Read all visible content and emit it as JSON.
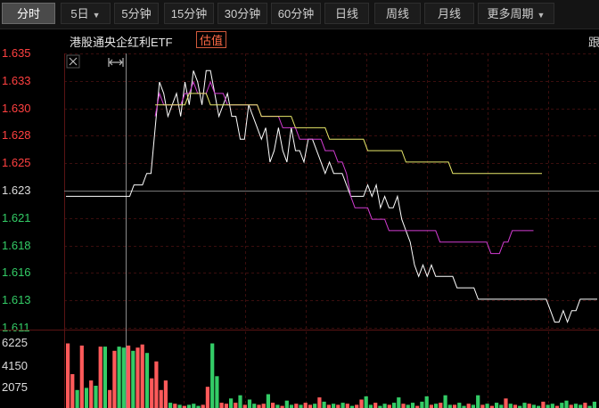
{
  "toolbar": {
    "tabs": [
      {
        "label": "分时",
        "active": true
      },
      {
        "label": "5日",
        "dropdown": true
      },
      {
        "label": "5分钟"
      },
      {
        "label": "15分钟"
      },
      {
        "label": "30分钟"
      },
      {
        "label": "60分钟"
      },
      {
        "label": "日线"
      },
      {
        "label": "周线"
      },
      {
        "label": "月线"
      },
      {
        "label": "更多周期",
        "dropdown": true
      }
    ]
  },
  "header": {
    "title": "港股通央企红利ETF",
    "badge": "估值",
    "cut_text": "跟"
  },
  "chart_data": {
    "type": "line",
    "price_axis": {
      "ticks": [
        "1.635",
        "1.633",
        "1.630",
        "1.628",
        "1.625",
        "1.623",
        "1.621",
        "1.618",
        "1.616",
        "1.613",
        "1.611"
      ],
      "ylim": [
        1.611,
        1.635
      ],
      "reference": 1.623
    },
    "volume_axis": {
      "ticks": [
        "6225",
        "4150",
        "2075"
      ]
    },
    "series": [
      {
        "color": "#ffffff",
        "values": [
          1.6225,
          1.6225,
          1.6225,
          1.6225,
          1.6225,
          1.6225,
          1.6225,
          1.6225,
          1.6225,
          1.6225,
          1.6225,
          1.6225,
          1.6225,
          1.6225,
          1.6225,
          1.6225,
          1.6235,
          1.6235,
          1.6235,
          1.6245,
          1.6245,
          1.6285,
          1.6325,
          1.6315,
          1.6295,
          1.6305,
          1.6315,
          1.6295,
          1.6325,
          1.6305,
          1.6335,
          1.6325,
          1.6305,
          1.6335,
          1.6335,
          1.6315,
          1.6295,
          1.6305,
          1.6315,
          1.6295,
          1.6295,
          1.6275,
          1.6275,
          1.6305,
          1.6295,
          1.6285,
          1.6275,
          1.6285,
          1.6255,
          1.6265,
          1.6285,
          1.6265,
          1.6255,
          1.6285,
          1.6265,
          1.6265,
          1.6255,
          1.6275,
          1.6275,
          1.6265,
          1.6255,
          1.6245,
          1.6255,
          1.6245,
          1.6245,
          1.6245,
          1.6235,
          1.6225,
          1.6225,
          1.6225,
          1.6225,
          1.6235,
          1.6225,
          1.6235,
          1.6215,
          1.6225,
          1.6215,
          1.6215,
          1.6225,
          1.6205,
          1.6195,
          1.6185,
          1.6165,
          1.6155,
          1.6165,
          1.6155,
          1.6165,
          1.6155,
          1.6155,
          1.6155,
          1.6155,
          1.6155,
          1.6145,
          1.6145,
          1.6145,
          1.6145,
          1.6145,
          1.6135,
          1.6135,
          1.6135,
          1.6135,
          1.6135,
          1.6135,
          1.6135,
          1.6135,
          1.6135,
          1.6135,
          1.6135,
          1.6135,
          1.6135,
          1.6135,
          1.6135,
          1.6135,
          1.6135,
          1.6125,
          1.6115,
          1.6115,
          1.6125,
          1.6115,
          1.6125,
          1.6125,
          1.6135,
          1.6135,
          1.6135,
          1.6135,
          1.6135
        ]
      },
      {
        "color": "#d23cd2",
        "values": [
          null,
          null,
          null,
          null,
          null,
          null,
          null,
          null,
          null,
          null,
          null,
          null,
          null,
          null,
          null,
          null,
          null,
          null,
          null,
          null,
          null,
          1.6295,
          1.6315,
          1.6305,
          1.6305,
          1.6305,
          1.6305,
          1.6305,
          1.6315,
          1.6315,
          1.6325,
          1.6315,
          1.6315,
          1.6315,
          1.6325,
          1.6315,
          1.6315,
          1.6315,
          1.6305,
          1.6305,
          1.6305,
          1.6305,
          1.6305,
          1.6305,
          1.6305,
          1.6305,
          1.6295,
          1.6295,
          1.6295,
          1.6295,
          1.6295,
          1.6285,
          1.6285,
          1.6285,
          1.6285,
          1.6275,
          1.6275,
          1.6275,
          1.6275,
          1.6275,
          1.6275,
          1.6265,
          1.6265,
          1.6265,
          1.6255,
          1.6255,
          1.6245,
          1.6225,
          1.6215,
          1.6215,
          1.6215,
          1.6215,
          1.6205,
          1.6205,
          1.6205,
          1.6205,
          1.6195,
          1.6195,
          1.6195,
          1.6195,
          1.6195,
          1.6195,
          1.6195,
          1.6195,
          1.6195,
          1.6195,
          1.6195,
          1.6195,
          1.6185,
          1.6185,
          1.6185,
          1.6185,
          1.6185,
          1.6185,
          1.6185,
          1.6185,
          1.6185,
          1.6185,
          1.6185,
          1.6185,
          1.6175,
          1.6175,
          1.6175,
          1.6185,
          1.6185,
          1.6195,
          1.6195,
          1.6195,
          1.6195,
          1.6195,
          1.6195
        ]
      },
      {
        "color": "#e8e86a",
        "values": [
          null,
          null,
          null,
          null,
          null,
          null,
          null,
          null,
          null,
          null,
          null,
          null,
          null,
          null,
          null,
          null,
          null,
          null,
          null,
          null,
          null,
          1.6305,
          1.6305,
          1.6305,
          1.6305,
          1.6305,
          1.6305,
          1.6305,
          1.6305,
          1.6315,
          1.6315,
          1.6315,
          1.6315,
          1.6315,
          1.6305,
          1.6305,
          1.6305,
          1.6305,
          1.6305,
          1.6305,
          1.6305,
          1.6305,
          1.6305,
          1.6305,
          1.6305,
          1.6305,
          1.6295,
          1.6295,
          1.6295,
          1.6295,
          1.6295,
          1.6295,
          1.6295,
          1.6295,
          1.6285,
          1.6285,
          1.6285,
          1.6285,
          1.6285,
          1.6285,
          1.6285,
          1.6285,
          1.6275,
          1.6275,
          1.6275,
          1.6275,
          1.6275,
          1.6275,
          1.6275,
          1.6275,
          1.6275,
          1.6265,
          1.6265,
          1.6265,
          1.6265,
          1.6265,
          1.6265,
          1.6265,
          1.6265,
          1.6265,
          1.6255,
          1.6255,
          1.6255,
          1.6255,
          1.6255,
          1.6255,
          1.6255,
          1.6255,
          1.6255,
          1.6255,
          1.6255,
          1.6245,
          1.6245,
          1.6245,
          1.6245,
          1.6245,
          1.6245,
          1.6245,
          1.6245,
          1.6245,
          1.6245,
          1.6245,
          1.6245,
          1.6245,
          1.6245,
          1.6245,
          1.6245,
          1.6245,
          1.6245,
          1.6245,
          1.6245,
          1.6245,
          1.6245
        ]
      }
    ],
    "volume_bars": [
      {
        "v": 6100,
        "c": "r"
      },
      {
        "v": 3200,
        "c": "r"
      },
      {
        "v": 1700,
        "c": "g"
      },
      {
        "v": 5900,
        "c": "r"
      },
      {
        "v": 1900,
        "c": "g"
      },
      {
        "v": 2600,
        "c": "r"
      },
      {
        "v": 2100,
        "c": "g"
      },
      {
        "v": 5800,
        "c": "r"
      },
      {
        "v": 5800,
        "c": "g"
      },
      {
        "v": 1700,
        "c": "r"
      },
      {
        "v": 5400,
        "c": "r"
      },
      {
        "v": 5800,
        "c": "g"
      },
      {
        "v": 5700,
        "c": "g"
      },
      {
        "v": 5900,
        "c": "r"
      },
      {
        "v": 5400,
        "c": "g"
      },
      {
        "v": 5700,
        "c": "r"
      },
      {
        "v": 6000,
        "c": "r"
      },
      {
        "v": 5200,
        "c": "g"
      },
      {
        "v": 2800,
        "c": "r"
      },
      {
        "v": 4400,
        "c": "r"
      },
      {
        "v": 1700,
        "c": "r"
      },
      {
        "v": 2600,
        "c": "r"
      },
      {
        "v": 500,
        "c": "g"
      },
      {
        "v": 400,
        "c": "r"
      },
      {
        "v": 300,
        "c": "g"
      },
      {
        "v": 200,
        "c": "r"
      },
      {
        "v": 300,
        "c": "g"
      },
      {
        "v": 400,
        "c": "g"
      },
      {
        "v": 200,
        "c": "g"
      },
      {
        "v": 300,
        "c": "r"
      },
      {
        "v": 2000,
        "c": "r"
      },
      {
        "v": 6100,
        "c": "g"
      },
      {
        "v": 3000,
        "c": "g"
      },
      {
        "v": 500,
        "c": "r"
      },
      {
        "v": 400,
        "c": "r"
      },
      {
        "v": 900,
        "c": "g"
      },
      {
        "v": 500,
        "c": "r"
      },
      {
        "v": 1200,
        "c": "g"
      },
      {
        "v": 300,
        "c": "r"
      },
      {
        "v": 800,
        "c": "g"
      },
      {
        "v": 400,
        "c": "g"
      },
      {
        "v": 300,
        "c": "r"
      },
      {
        "v": 400,
        "c": "r"
      },
      {
        "v": 1300,
        "c": "g"
      },
      {
        "v": 500,
        "c": "r"
      },
      {
        "v": 300,
        "c": "g"
      },
      {
        "v": 200,
        "c": "r"
      },
      {
        "v": 700,
        "c": "g"
      },
      {
        "v": 300,
        "c": "g"
      },
      {
        "v": 400,
        "c": "r"
      },
      {
        "v": 300,
        "c": "g"
      },
      {
        "v": 500,
        "c": "r"
      },
      {
        "v": 300,
        "c": "r"
      },
      {
        "v": 400,
        "c": "g"
      },
      {
        "v": 1000,
        "c": "r"
      },
      {
        "v": 600,
        "c": "g"
      },
      {
        "v": 300,
        "c": "r"
      },
      {
        "v": 400,
        "c": "g"
      },
      {
        "v": 300,
        "c": "r"
      },
      {
        "v": 500,
        "c": "g"
      },
      {
        "v": 400,
        "c": "r"
      },
      {
        "v": 200,
        "c": "g"
      },
      {
        "v": 300,
        "c": "r"
      },
      {
        "v": 800,
        "c": "r"
      },
      {
        "v": 1100,
        "c": "g"
      },
      {
        "v": 300,
        "c": "g"
      },
      {
        "v": 500,
        "c": "r"
      },
      {
        "v": 200,
        "c": "g"
      },
      {
        "v": 400,
        "c": "g"
      },
      {
        "v": 300,
        "c": "r"
      },
      {
        "v": 500,
        "c": "g"
      },
      {
        "v": 1000,
        "c": "g"
      },
      {
        "v": 400,
        "c": "r"
      },
      {
        "v": 300,
        "c": "g"
      },
      {
        "v": 500,
        "c": "g"
      },
      {
        "v": 200,
        "c": "r"
      },
      {
        "v": 600,
        "c": "g"
      },
      {
        "v": 1100,
        "c": "g"
      },
      {
        "v": 300,
        "c": "r"
      },
      {
        "v": 400,
        "c": "g"
      },
      {
        "v": 500,
        "c": "r"
      },
      {
        "v": 1200,
        "c": "g"
      },
      {
        "v": 300,
        "c": "g"
      },
      {
        "v": 300,
        "c": "r"
      },
      {
        "v": 500,
        "c": "g"
      },
      {
        "v": 200,
        "c": "g"
      },
      {
        "v": 400,
        "c": "r"
      },
      {
        "v": 300,
        "c": "g"
      },
      {
        "v": 1200,
        "c": "g"
      },
      {
        "v": 300,
        "c": "r"
      },
      {
        "v": 400,
        "c": "g"
      },
      {
        "v": 200,
        "c": "r"
      },
      {
        "v": 500,
        "c": "g"
      },
      {
        "v": 300,
        "c": "g"
      },
      {
        "v": 900,
        "c": "r"
      },
      {
        "v": 400,
        "c": "g"
      },
      {
        "v": 300,
        "c": "r"
      },
      {
        "v": 200,
        "c": "g"
      },
      {
        "v": 500,
        "c": "g"
      },
      {
        "v": 400,
        "c": "r"
      },
      {
        "v": 300,
        "c": "g"
      },
      {
        "v": 200,
        "c": "g"
      },
      {
        "v": 600,
        "c": "r"
      },
      {
        "v": 300,
        "c": "g"
      },
      {
        "v": 400,
        "c": "g"
      },
      {
        "v": 200,
        "c": "r"
      },
      {
        "v": 500,
        "c": "g"
      },
      {
        "v": 700,
        "c": "g"
      },
      {
        "v": 300,
        "c": "r"
      },
      {
        "v": 400,
        "c": "g"
      },
      {
        "v": 300,
        "c": "g"
      },
      {
        "v": 500,
        "c": "r"
      },
      {
        "v": 200,
        "c": "g"
      },
      {
        "v": 600,
        "c": "g"
      }
    ]
  },
  "colors": {
    "up": "#ff4040",
    "down": "#33cc66",
    "flat": "#dddddd",
    "grid": "#3a1010"
  }
}
